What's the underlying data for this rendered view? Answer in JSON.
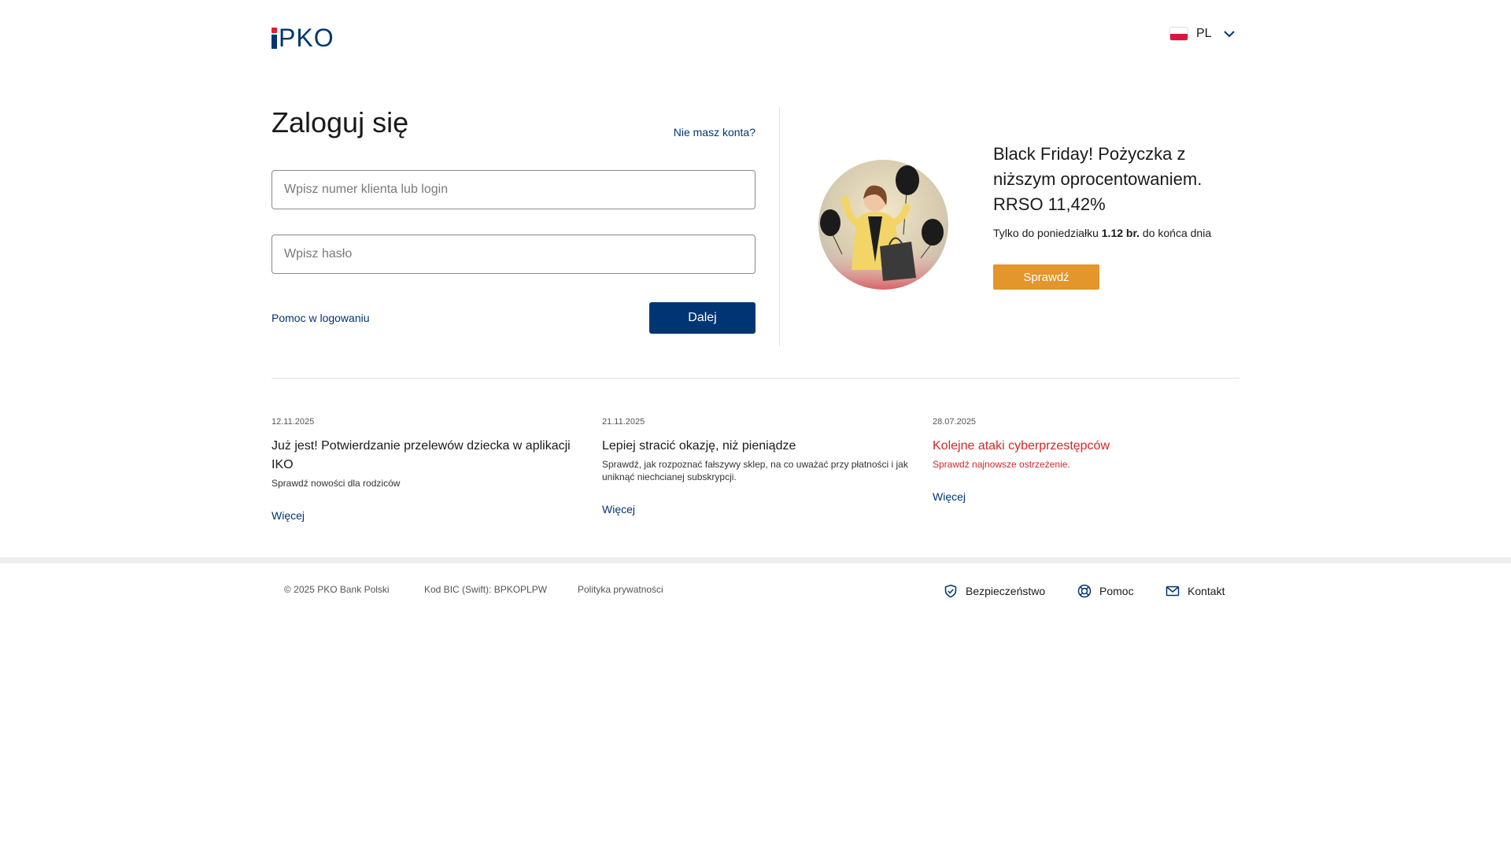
{
  "header": {
    "logo_text": "PKO",
    "language": {
      "code": "PL"
    }
  },
  "login": {
    "title": "Zaloguj się",
    "no_account_link": "Nie masz konta?",
    "login_placeholder": "Wpisz numer klienta lub login",
    "password_placeholder": "Wpisz hasło",
    "help_link": "Pomoc w logowaniu",
    "next_button": "Dalej"
  },
  "promo": {
    "title": "Black Friday! Pożyczka z niższym oprocentowaniem. RRSO 11,42%",
    "subtitle_prefix": "Tylko do poniedziałku",
    "subtitle_bold": "1.12 br.",
    "subtitle_suffix": "do końca dnia",
    "button": "Sprawdź"
  },
  "news": [
    {
      "date": "12.11.2025",
      "title": "Już jest! Potwierdzanie przelewów dziecka w aplikacji IKO",
      "description": "Sprawdź nowości dla rodziców",
      "more": "Więcej"
    },
    {
      "date": "21.11.2025",
      "title": "Lepiej stracić okazję, niż pieniądze",
      "description": "Sprawdź, jak rozpoznać fałszywy sklep, na co uważać przy płatności i jak uniknąć niechcianej subskrypcji.",
      "more": "Więcej"
    },
    {
      "date": "28.07.2025",
      "title": "Kolejne ataki cyberprzestępców",
      "description": "Sprawdź najnowsze ostrzeżenie.",
      "more": "Więcej"
    }
  ],
  "footer": {
    "copyright": "© 2025 PKO Bank Polski",
    "bic": "Kod BIC (Swift): BPKOPLPW",
    "privacy": "Polityka prywatności",
    "links": {
      "security": "Bezpieczeństwo",
      "help": "Pomoc",
      "contact": "Kontakt"
    }
  },
  "colors": {
    "brand_navy": "#003574",
    "brand_red": "#e31e24",
    "promo_orange": "#e3962b",
    "alert_red": "#d0282a"
  },
  "icons": {
    "language_flag": "poland-flag-icon",
    "language_chevron": "chevron-down-icon",
    "security": "shield-check-icon",
    "help": "lifebuoy-icon",
    "contact": "envelope-icon"
  }
}
